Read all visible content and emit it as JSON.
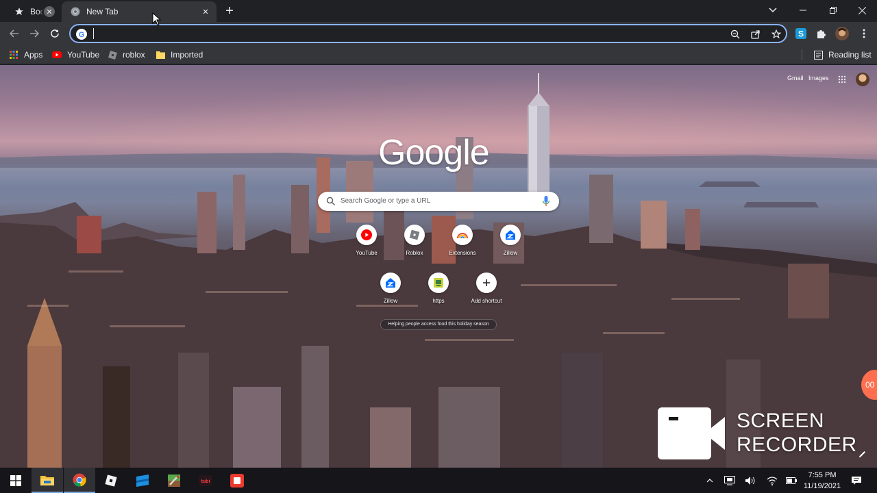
{
  "browser": {
    "tabs": [
      {
        "title": "Boo",
        "favicon": "star-icon",
        "active": false
      },
      {
        "title": "New Tab",
        "favicon": "chrome-icon",
        "active": true
      }
    ],
    "new_tab_symbol": "+",
    "omnibox": {
      "value": "",
      "favicon": "google-g-icon"
    },
    "bookmarks": [
      {
        "label": "Apps",
        "icon": "apps-grid-icon"
      },
      {
        "label": "YouTube",
        "icon": "youtube-icon"
      },
      {
        "label": "roblox",
        "icon": "roblox-icon"
      },
      {
        "label": "Imported",
        "icon": "folder-icon"
      }
    ],
    "reading_list": "Reading list"
  },
  "newtab": {
    "top_links": {
      "gmail": "Gmail",
      "images": "Images"
    },
    "logo": "Google",
    "search_placeholder": "Search Google or type a URL",
    "shortcuts": [
      {
        "label": "YouTube",
        "icon": "youtube-icon"
      },
      {
        "label": "Roblox",
        "icon": "roblox-icon"
      },
      {
        "label": "Extensions",
        "icon": "extensions-rainbow-icon"
      },
      {
        "label": "Zillow",
        "icon": "zillow-icon"
      },
      {
        "label": "Zillow",
        "icon": "zillow-icon"
      },
      {
        "label": "https",
        "icon": "generic-site-icon"
      },
      {
        "label": "Add shortcut",
        "icon": "plus-icon"
      }
    ],
    "promo": "Helping people access food this holiday season"
  },
  "watermark": {
    "line1": "SCREEN",
    "line2": "RECORDER",
    "badge": "00"
  },
  "taskbar": {
    "time": "7:55 PM",
    "date": "11/19/2021",
    "apps": [
      "start-icon",
      "file-explorer-icon",
      "chrome-icon",
      "roblox-icon",
      "microsoft-store-icon",
      "minecraft-icon",
      "tubi-icon",
      "screen-recorder-icon"
    ]
  },
  "colors": {
    "accent": "#8ab4f8",
    "tab_active": "#35363a",
    "frame": "#202124"
  }
}
